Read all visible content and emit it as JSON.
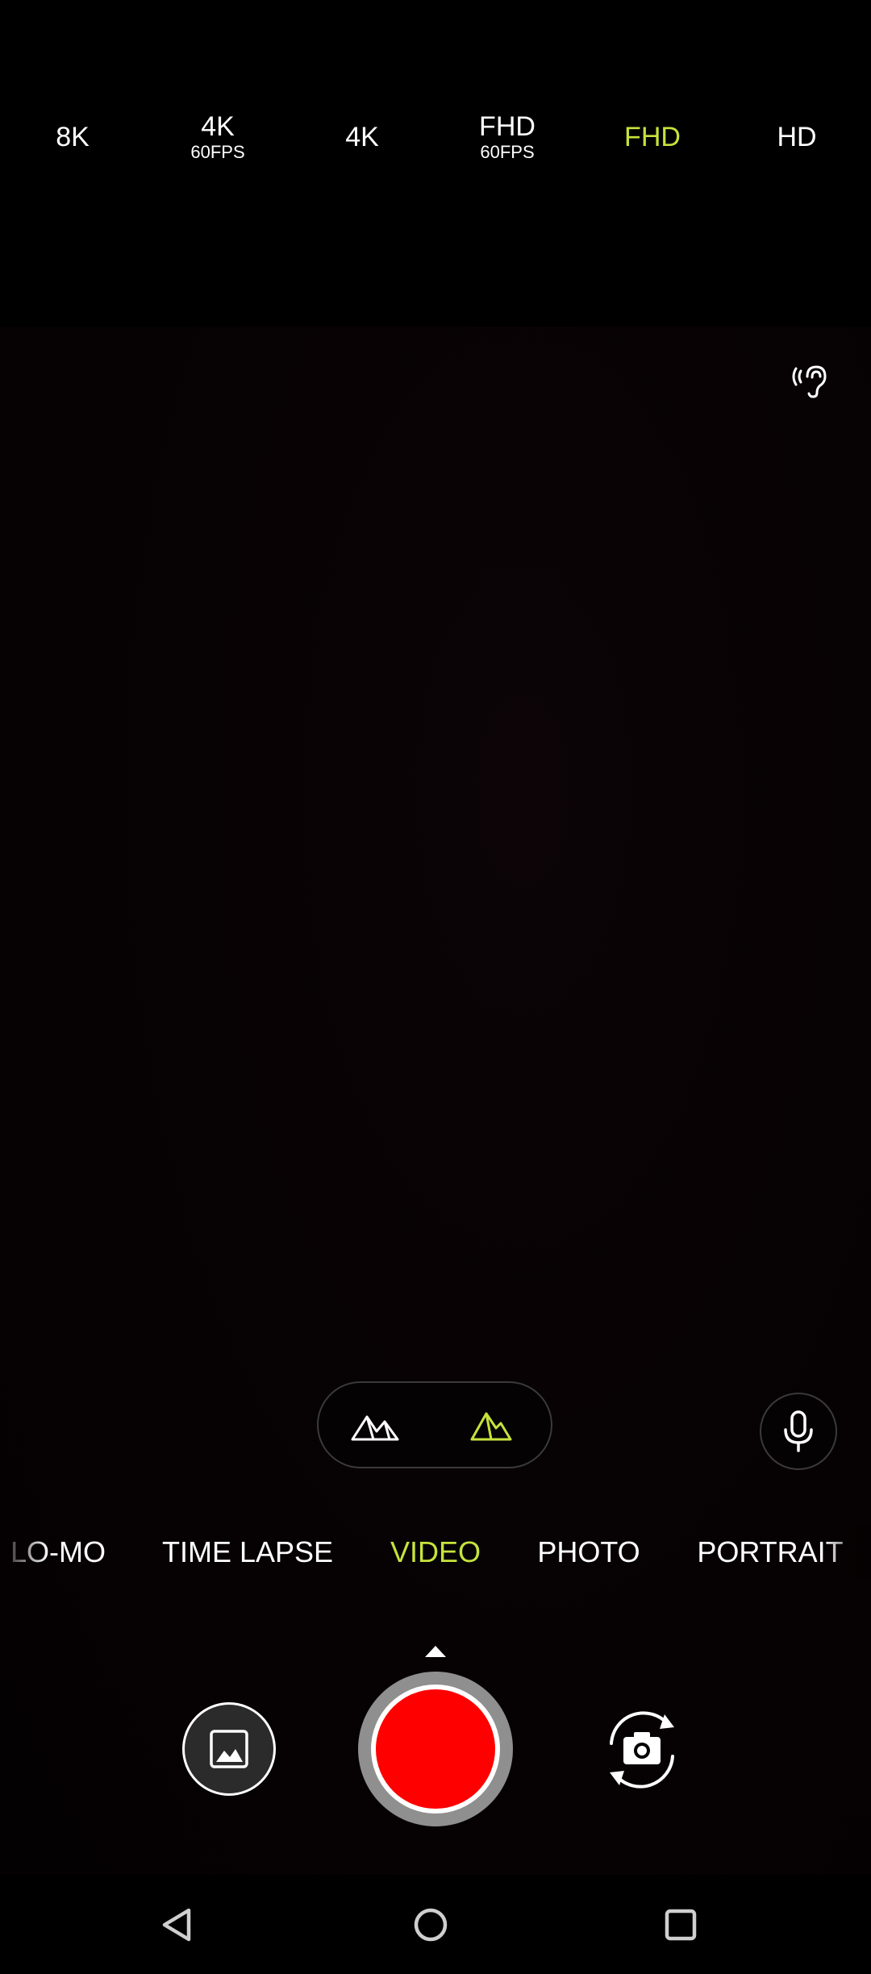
{
  "resolution_bar": {
    "items": [
      {
        "label": "8K",
        "sub": ""
      },
      {
        "label": "4K",
        "sub": "60FPS"
      },
      {
        "label": "4K",
        "sub": ""
      },
      {
        "label": "FHD",
        "sub": "60FPS"
      },
      {
        "label": "FHD",
        "sub": "",
        "selected": true
      },
      {
        "label": "HD",
        "sub": ""
      }
    ]
  },
  "modes": {
    "items": [
      "LO-MO",
      "TIME LAPSE",
      "VIDEO",
      "PHOTO",
      "PORTRAIT"
    ],
    "selected": "VIDEO"
  },
  "colors": {
    "accent": "#c6e33c",
    "record": "#ff0000",
    "background": "#000000"
  },
  "icons": {
    "hearing": "hearing-icon",
    "lens_wide": "mountains-wide-icon",
    "lens_normal": "mountain-icon",
    "microphone": "microphone-icon",
    "gallery": "image-icon",
    "switch_camera": "switch-camera-icon",
    "nav_back": "back-triangle-icon",
    "nav_home": "home-circle-icon",
    "nav_recents": "recents-square-icon"
  }
}
